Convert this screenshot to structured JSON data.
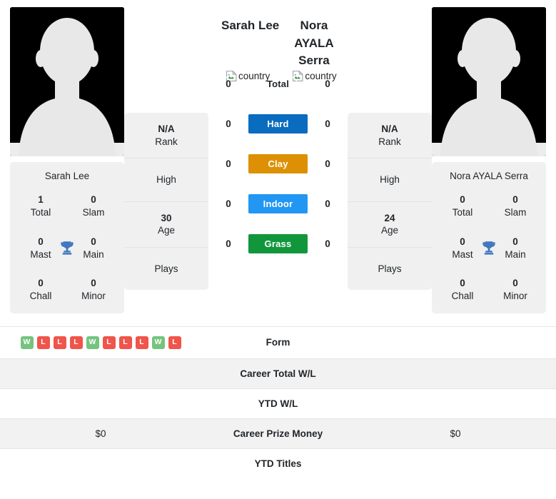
{
  "players": {
    "left": {
      "name": "Sarah Lee",
      "card_name": "Sarah Lee",
      "avatar_icon": "person-silhouette-avatar",
      "flag_alt": "country",
      "rank": "N/A",
      "rank_label": "Rank",
      "high_label": "High",
      "age": "30",
      "age_label": "Age",
      "plays_label": "Plays",
      "titles": {
        "total": "1",
        "total_label": "Total",
        "slam": "0",
        "slam_label": "Slam",
        "mast": "0",
        "mast_label": "Mast",
        "main": "0",
        "main_label": "Main",
        "chall": "0",
        "chall_label": "Chall",
        "minor": "0",
        "minor_label": "Minor"
      }
    },
    "right": {
      "name": "Nora AYALA Serra",
      "card_name": "Nora AYALA Serra",
      "avatar_icon": "person-silhouette-avatar",
      "flag_alt": "country",
      "rank": "N/A",
      "rank_label": "Rank",
      "high_label": "High",
      "age": "24",
      "age_label": "Age",
      "plays_label": "Plays",
      "titles": {
        "total": "0",
        "total_label": "Total",
        "slam": "0",
        "slam_label": "Slam",
        "mast": "0",
        "mast_label": "Mast",
        "main": "0",
        "main_label": "Main",
        "chall": "0",
        "chall_label": "Chall",
        "minor": "0",
        "minor_label": "Minor"
      }
    }
  },
  "surfaces": [
    {
      "label": "Total",
      "left": "0",
      "right": "0",
      "color": "",
      "plain": true
    },
    {
      "label": "Hard",
      "left": "0",
      "right": "0",
      "color": "#0a6cbf",
      "plain": false
    },
    {
      "label": "Clay",
      "left": "0",
      "right": "0",
      "color": "#dd9003",
      "plain": false
    },
    {
      "label": "Indoor",
      "left": "0",
      "right": "0",
      "color": "#2196f3",
      "plain": false
    },
    {
      "label": "Grass",
      "left": "0",
      "right": "0",
      "color": "#12963c",
      "plain": false
    }
  ],
  "stat_rows": [
    {
      "label": "Form",
      "left_form": [
        "W",
        "L",
        "L",
        "L",
        "W",
        "L",
        "L",
        "L",
        "W",
        "L"
      ],
      "right_form": [],
      "left": "",
      "right": "",
      "striped": false
    },
    {
      "label": "Career Total W/L",
      "left": "",
      "right": "",
      "striped": true
    },
    {
      "label": "YTD W/L",
      "left": "",
      "right": "",
      "striped": false
    },
    {
      "label": "Career Prize Money",
      "left": "$0",
      "right": "$0",
      "striped": true
    },
    {
      "label": "YTD Titles",
      "left": "",
      "right": "",
      "striped": false
    }
  ],
  "colors": {
    "hard": "#0a6cbf",
    "clay": "#dd9003",
    "indoor": "#2196f3",
    "grass": "#12963c",
    "win": "#74c47e",
    "loss": "#f0544a",
    "card_bg": "#f0f0f0",
    "trophy": "#4178be"
  }
}
